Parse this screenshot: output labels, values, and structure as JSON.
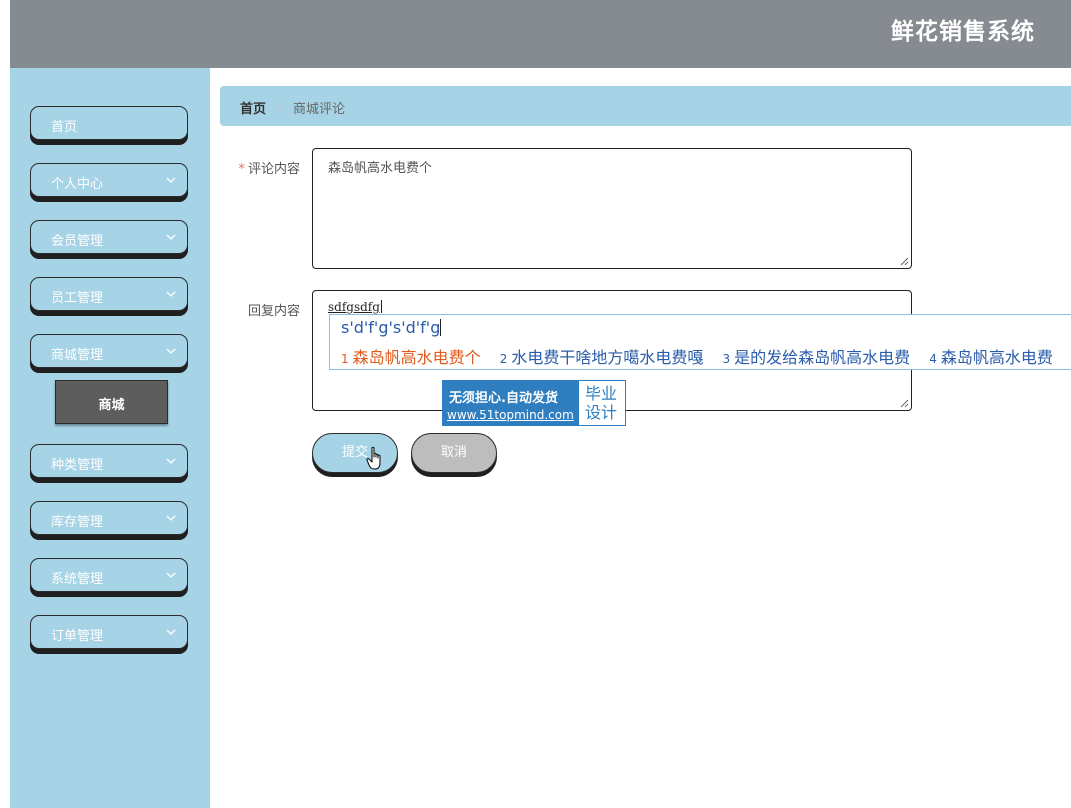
{
  "header": {
    "title": "鲜花销售系统"
  },
  "sidebar": {
    "items": [
      {
        "label": "首页",
        "has_chevron": false
      },
      {
        "label": "个人中心",
        "has_chevron": true
      },
      {
        "label": "会员管理",
        "has_chevron": true
      },
      {
        "label": "员工管理",
        "has_chevron": true
      },
      {
        "label": "商城管理",
        "has_chevron": true
      },
      {
        "label": "种类管理",
        "has_chevron": true
      },
      {
        "label": "库存管理",
        "has_chevron": true
      },
      {
        "label": "系统管理",
        "has_chevron": true
      },
      {
        "label": "订单管理",
        "has_chevron": true
      }
    ],
    "submenu": {
      "label": "商城"
    }
  },
  "breadcrumb": {
    "home": "首页",
    "separator": "/",
    "current": "商城评论"
  },
  "form": {
    "comment": {
      "required_mark": "*",
      "label": "评论内容",
      "value": "森岛帆高水电费个"
    },
    "reply": {
      "label": "回复内容",
      "value": "sdfgsdfg"
    },
    "submit_label": "提交",
    "cancel_label": "取消"
  },
  "ime": {
    "composition": "s'd'f'g's'd'f'g",
    "candidates": [
      {
        "num": "1",
        "text": "森岛帆高水电费个"
      },
      {
        "num": "2",
        "text": "水电费干啥地方噶水电费嘎"
      },
      {
        "num": "3",
        "text": "是的发给森岛帆高水电费"
      },
      {
        "num": "4",
        "text": "森岛帆高水电费"
      }
    ]
  },
  "watermark": {
    "line1": "无须担心.自动发货",
    "line2": "www.51topmind.com",
    "right_line1": "毕业",
    "right_line2": "设计"
  },
  "colors": {
    "topbar": "#858b91",
    "sidebar": "#a6d4e6",
    "submenu_bg": "#5d5d5d",
    "required": "#f56c6c",
    "ime_text": "#2a5caa",
    "ime_selected": "#e05a1c",
    "watermark": "#2f7ec0"
  },
  "icons": {
    "chevron": "chevron-down-icon",
    "cursor": "hand-pointer-icon",
    "resize": "resize-grip-icon"
  }
}
